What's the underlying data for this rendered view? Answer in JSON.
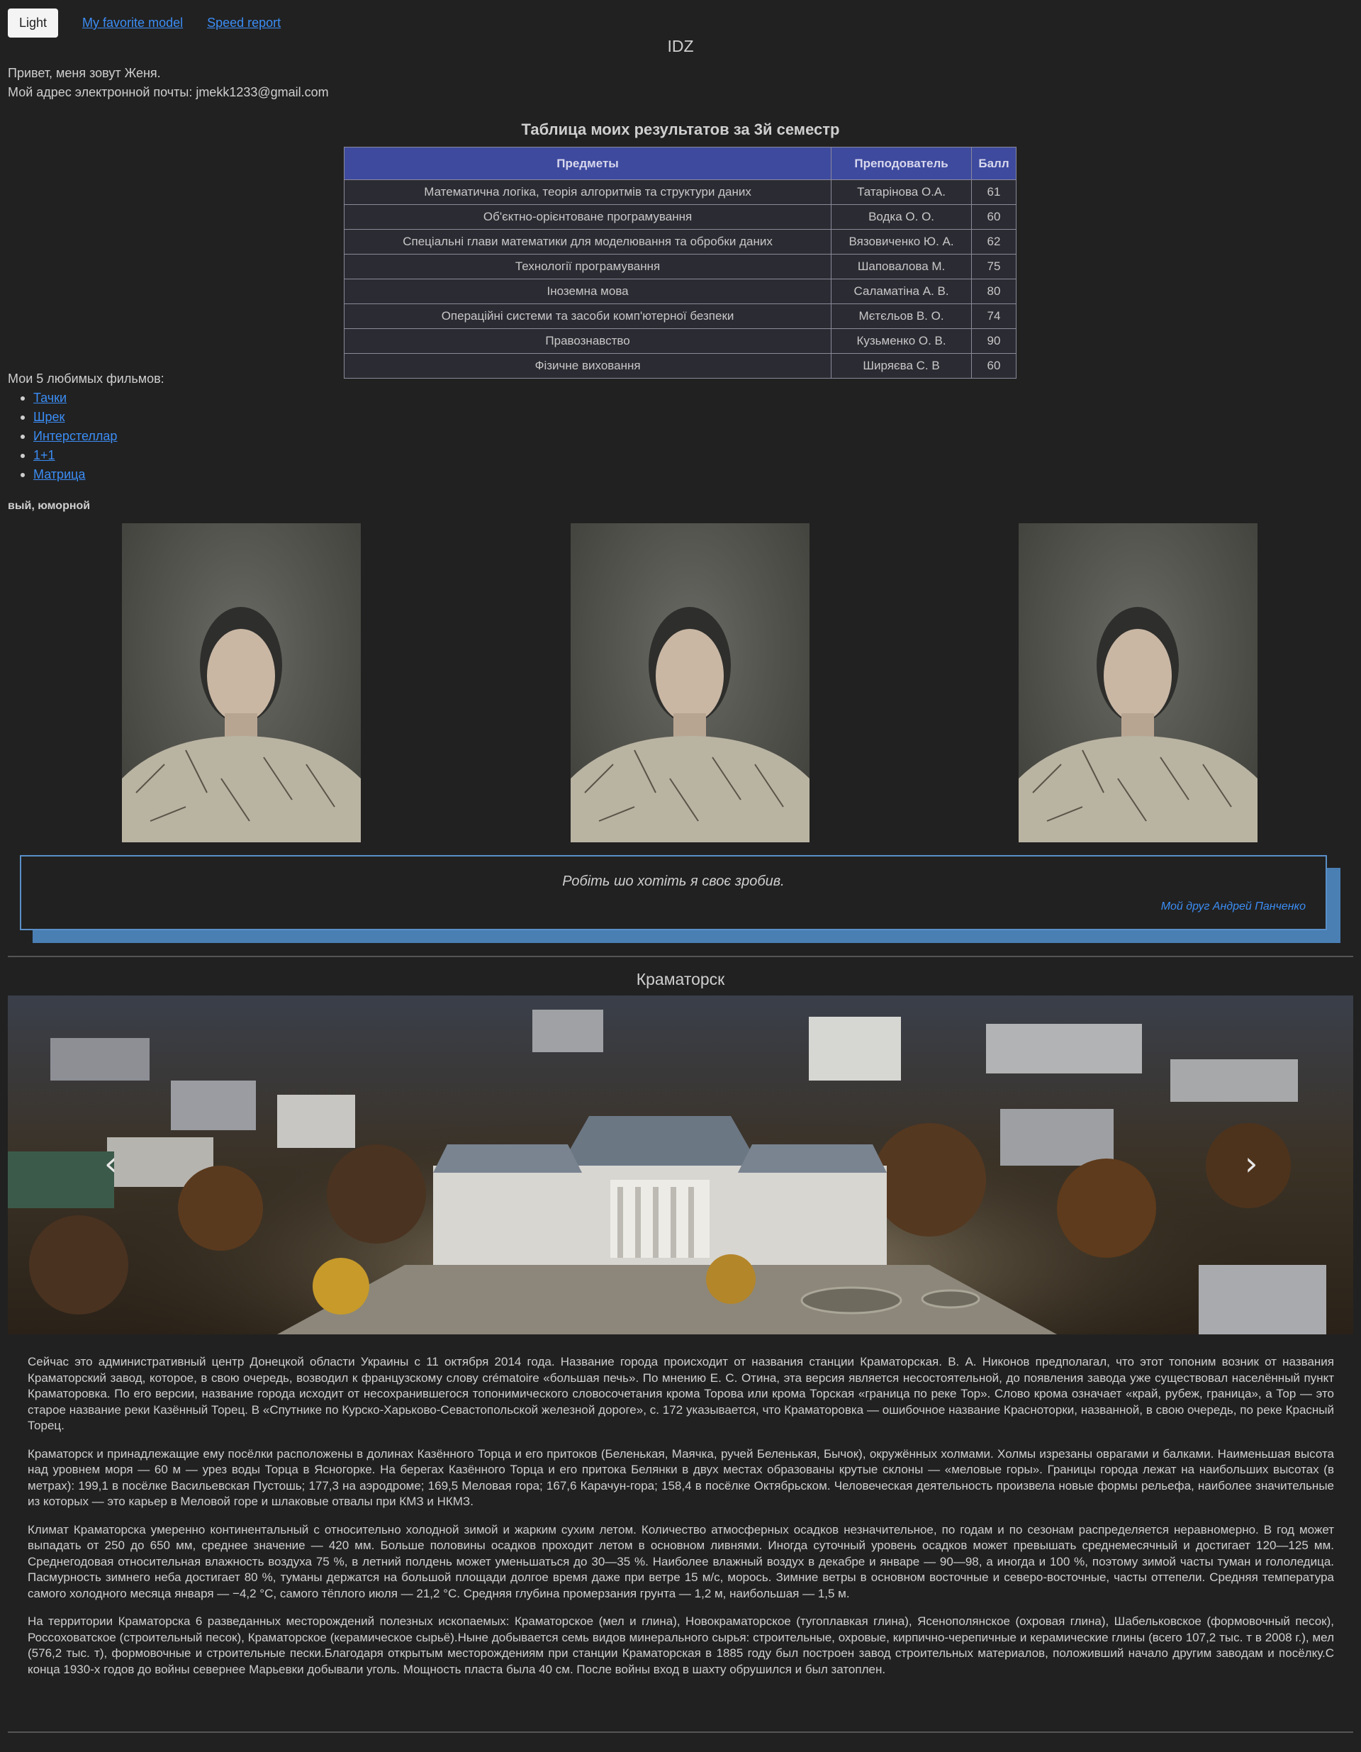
{
  "nav": {
    "theme_button": "Light",
    "link_model": "My favorite model",
    "link_speed": "Speed report"
  },
  "site_title": "IDZ",
  "intro": {
    "line1": "Привет, меня зовут Женя.",
    "line2": "Мой адрес электронной почты: jmekk1233@gmail.com"
  },
  "grades": {
    "title": "Таблица моих результатов за 3й семестр",
    "headers": [
      "Предметы",
      "Преподователь",
      "Балл"
    ],
    "rows": [
      [
        "Математична логіка, теорія алгоритмів та структури даних",
        "Татарінова О.А.",
        "61"
      ],
      [
        "Об'єктно-орієнтоване програмування",
        "Водка О. О.",
        "60"
      ],
      [
        "Спеціальні глави математики для моделювання та обробки даних",
        "Вязовиченко Ю. А.",
        "62"
      ],
      [
        "Технології програмування",
        "Шаповалова М.",
        "75"
      ],
      [
        "Іноземна мова",
        "Саламатіна А. В.",
        "80"
      ],
      [
        "Операційні системи та засоби комп'ютерної безпеки",
        "Мєтєльов В. О.",
        "74"
      ],
      [
        "Правознавство",
        "Кузьменко О. В.",
        "90"
      ],
      [
        "Фізичне виховання",
        "Ширяєва С. В",
        "60"
      ]
    ]
  },
  "films": {
    "title": "Мои 5 любимых фильмов:",
    "items": [
      "Тачки",
      "Шрек",
      "Интерстеллар",
      "1+1",
      "Матрица"
    ]
  },
  "trait_text": "вый, юморной",
  "quote": {
    "text": "Робіть шо хотіть я своє зробив.",
    "author": "Мой друг Андрей Панченко"
  },
  "city": {
    "title": "Краматорск",
    "paragraphs": [
      "Сейчас это административный центр Донецкой области Украины с 11 октября 2014 года. Название города происходит от названия станции Краматорская. В. А. Никонов предполагал, что этот топоним возник от названия Краматорский завод, которое, в свою очередь, возводил к французскому слову crématoire «большая печь». По мнению Е. С. Отина, эта версия является несостоятельной, до появления завода уже существовал населённый пункт Краматоровка. По его версии, название города исходит от несохранившегося топонимического словосочетания крома Торова или крома Торская «граница по реке Тор». Слово крома означает «край, рубеж, граница», а Тор — это старое название реки Казённый Торец. В «Спутнике по Курско-Харьково-Севастопольской железной дороге», с. 172 указывается, что Краматоровка — ошибочное название Красноторки, названной, в свою очередь, по реке Красный Торец.",
      "Краматорск и принадлежащие ему посёлки расположены в долинах Казённого Торца и его притоков (Беленькая, Маячка, ручей Беленькая, Бычок), окружённых холмами. Холмы изрезаны оврагами и балками. Наименьшая высота над уровнем моря — 60 м — урез воды Торца в Ясногорке. На берегах Казённого Торца и его притока Белянки в двух местах образованы крутые склоны — «меловые горы». Границы города лежат на наибольших высотах (в метрах): 199,1 в посёлке Васильевская Пустошь; 177,3 на аэродроме; 169,5 Меловая гора; 167,6 Карачун-гора; 158,4 в посёлке Октябрьском. Человеческая деятельность произвела новые формы рельефа, наиболее значительные из которых — это карьер в Меловой горе и шлаковые отвалы при КМЗ и НКМЗ.",
      "Климат Краматорска умеренно континентальный с относительно холодной зимой и жарким сухим летом. Количество атмосферных осадков незначительное, по годам и по сезонам распределяется неравномерно. В год может выпадать от 250 до 650 мм, среднее значение — 420 мм. Больше половины осадков проходит летом в основном ливнями. Иногда суточный уровень осадков может превышать среднемесячный и достигает 120—125 мм. Среднегодовая относительная влажность воздуха 75 %, в летний полдень может уменьшаться до 30—35 %. Наиболее влажный воздух в декабре и январе — 90—98, а иногда и 100 %, поэтому зимой часты туман и гололедица. Пасмурность зимнего неба достигает 80 %, туманы держатся на большой площади долгое время даже при ветре 15 м/с, морось. Зимние ветры в основном восточные и северо-восточные, часты оттепели. Средняя температура самого холодного месяца января — −4,2 °C, самого тёплого июля — 21,2 °C. Средняя глубина промерзания грунта — 1,2 м, наибольшая — 1,5 м.",
      "На территории Краматорска 6 разведанных месторождений полезных ископаемых: Краматорское (мел и глина), Новокраматорское (тугоплавкая глина), Ясенополянское (охровая глина), Шабельковское (формовочный песок), Россоховатское (строительный песок), Краматорское (керамическое сырьё).Ныне добывается семь видов минерального сырья: строительные, охровые, кирпично-черепичные и керамические глины (всего 107,2 тыс. т в 2008 г.), мел (576,2 тыс. т), формовочные и строительные пески.Благодаря открытым месторождениям при станции Краматорская в 1885 году был построен завод строительных материалов, положивший начало другим заводам и посёлку.С конца 1930-х годов до войны севернее Марьевки добывали уголь. Мощность пласта была 40 см. После войны вход в шахту обрушился и был затоплен."
    ]
  },
  "icons": {
    "carousel_prev": "chevron-left-icon",
    "carousel_next": "chevron-right-icon"
  }
}
